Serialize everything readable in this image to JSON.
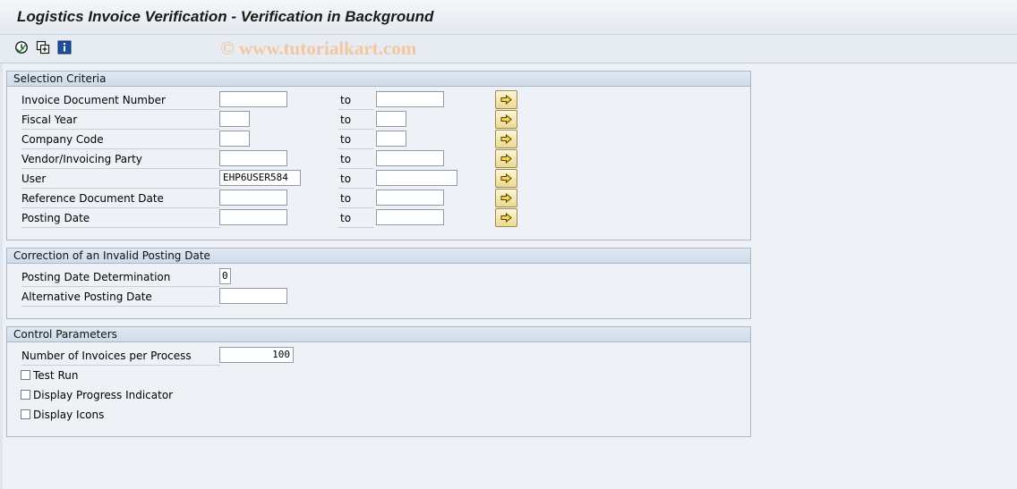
{
  "window": {
    "title": "Logistics Invoice Verification - Verification in Background",
    "watermark": "© www.tutorialkart.com"
  },
  "toolbar": {
    "buttons": [
      {
        "icon": "execute-clock-icon"
      },
      {
        "icon": "save-variant-icon"
      },
      {
        "icon": "info-icon"
      }
    ]
  },
  "selection_criteria": {
    "title": "Selection Criteria",
    "to_label": "to",
    "rows": [
      {
        "label": "Invoice Document Number",
        "from": "",
        "to": ""
      },
      {
        "label": "Fiscal Year",
        "from": "",
        "to": ""
      },
      {
        "label": "Company Code",
        "from": "",
        "to": ""
      },
      {
        "label": "Vendor/Invoicing Party",
        "from": "",
        "to": ""
      },
      {
        "label": "User",
        "from": "EHP6USER584",
        "to": ""
      },
      {
        "label": "Reference Document Date",
        "from": "",
        "to": ""
      },
      {
        "label": "Posting Date",
        "from": "",
        "to": ""
      }
    ]
  },
  "correction": {
    "title": "Correction of an Invalid Posting Date",
    "posting_date_determination": {
      "label": "Posting Date Determination",
      "value": "0"
    },
    "alternative_posting_date": {
      "label": "Alternative Posting Date",
      "value": ""
    }
  },
  "control_parameters": {
    "title": "Control Parameters",
    "invoices_per_process": {
      "label": "Number of Invoices per Process",
      "value": "100"
    },
    "test_run": {
      "label": "Test Run",
      "checked": false
    },
    "display_progress": {
      "label": "Display Progress Indicator",
      "checked": false
    },
    "display_icons": {
      "label": "Display Icons",
      "checked": false
    }
  },
  "colors": {
    "multiple_selection_button": "#ecd98e",
    "watermark": "#f4c6a0"
  }
}
